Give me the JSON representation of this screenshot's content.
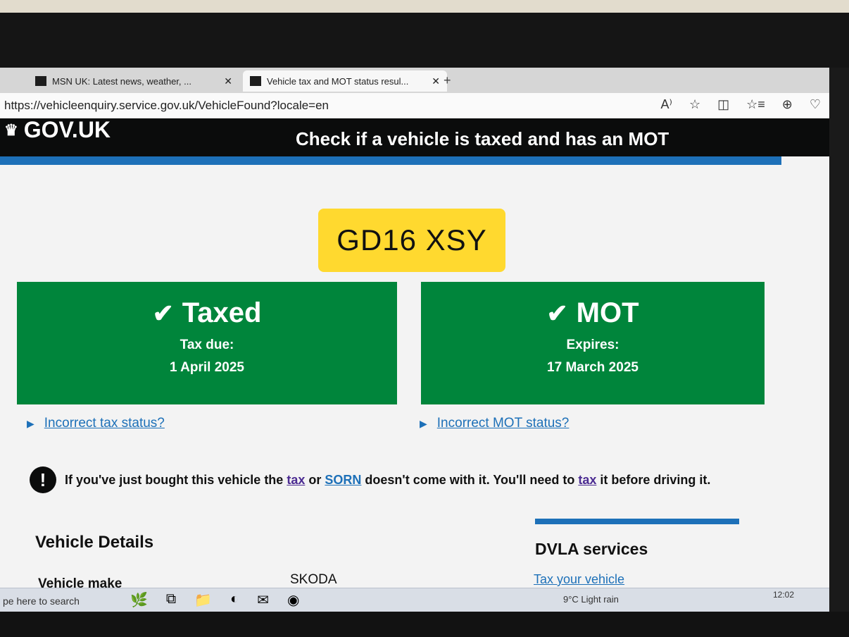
{
  "browser": {
    "tabs": [
      {
        "label": "MSN UK: Latest news, weather, ..."
      },
      {
        "label": "Vehicle tax and MOT status resul..."
      }
    ],
    "url": "https://vehicleenquiry.service.gov.uk/VehicleFound?locale=en"
  },
  "header": {
    "logo": "GOV.UK",
    "service_name": "Check if a vehicle is taxed and has an MOT"
  },
  "plate": "GD16 XSY",
  "tax_panel": {
    "status": "Taxed",
    "label": "Tax due:",
    "date": "1 April 2025"
  },
  "mot_panel": {
    "status": "MOT",
    "label": "Expires:",
    "date": "17 March 2025"
  },
  "links": {
    "incorrect_tax": "Incorrect tax status?",
    "incorrect_mot": "Incorrect MOT status?"
  },
  "warning": {
    "part1": "If you've just bought this vehicle the",
    "link1": "tax",
    "part2": "or",
    "link2": "SORN",
    "part3": "doesn't come with it. You'll need to",
    "link3": "tax",
    "part4": "it before driving it."
  },
  "vehicle_details": {
    "heading": "Vehicle Details",
    "rows": [
      {
        "label": "Vehicle make",
        "value": "SKODA"
      }
    ]
  },
  "dvla_services": {
    "heading": "DVLA services",
    "links": [
      "Tax your vehicle"
    ]
  },
  "taskbar": {
    "search_placeholder": "pe here to search",
    "weather": "9°C  Light rain",
    "clock": "12:02"
  },
  "colors": {
    "gov_black": "#0b0c0c",
    "gov_blue": "#1d70b8",
    "success_green": "#00853b",
    "plate_yellow": "#ffd92f"
  }
}
